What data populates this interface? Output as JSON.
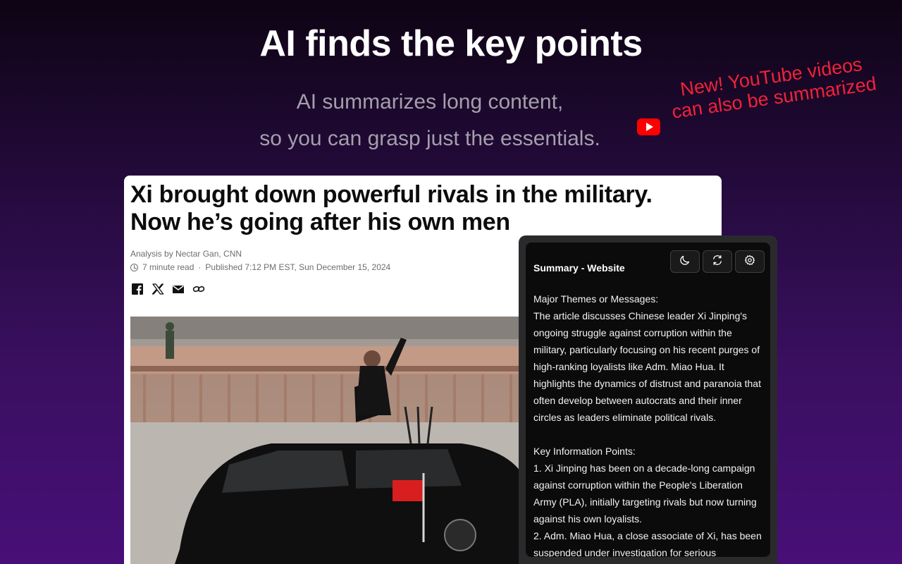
{
  "hero": {
    "title": "AI finds the key points",
    "subtitle_line1": "AI summarizes long content,",
    "subtitle_line2": "so you can grasp just the essentials."
  },
  "promo": {
    "icon": "youtube-play-icon",
    "line1": "New! YouTube videos",
    "line2": "can also be summarized",
    "color": "#f0223a"
  },
  "article": {
    "title_line1": "Xi brought down powerful rivals in the military.",
    "title_line2": "Now he’s going after his own men",
    "byline": "Analysis by Nectar Gan, CNN",
    "read_time": "7 minute read",
    "separator": "·",
    "published": "Published 7:12 PM EST, Sun December 15, 2024",
    "share_icons": [
      "facebook-icon",
      "x-icon",
      "email-icon",
      "link-icon"
    ]
  },
  "summary_panel": {
    "title": "Summary - Website",
    "buttons": [
      "moon-icon",
      "refresh-icon",
      "gear-icon"
    ],
    "section1_heading": "Major Themes or Messages:",
    "section1_text": "The article discusses Chinese leader Xi Jinping's ongoing struggle against corruption within the military, particularly focusing on his recent purges of high-ranking loyalists like Adm. Miao Hua. It highlights the dynamics of distrust and paranoia that often develop between autocrats and their inner circles as leaders eliminate political rivals.",
    "section2_heading": "Key Information Points:",
    "point1": "1. Xi Jinping has been on a decade-long campaign against corruption within the People's Liberation Army (PLA), initially targeting rivals but now turning against his own loyalists.",
    "point2": "2. Adm. Miao Hua, a close associate of Xi, has been suspended under investigation for serious"
  },
  "colors": {
    "background_top": "#0e0414",
    "background_bottom": "#480f78",
    "panel_bg": "#0b0b0b",
    "panel_frame": "#2a2a2c"
  }
}
